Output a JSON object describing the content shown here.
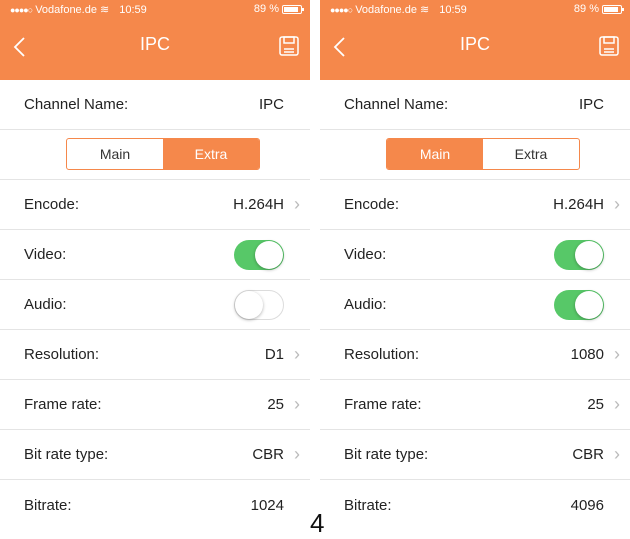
{
  "colors": {
    "accent": "#F5884B",
    "toggle_on": "#57C868"
  },
  "screens": [
    {
      "status": {
        "carrier": "Vodafone.de",
        "time": "10:59",
        "battery": "89 %",
        "battery_level": 0.89
      },
      "title": "IPC",
      "channel": {
        "label": "Channel Name:",
        "value": "IPC"
      },
      "tabs": [
        {
          "label": "Main",
          "active": false
        },
        {
          "label": "Extra",
          "active": true
        }
      ],
      "encode": {
        "label": "Encode:",
        "value": "H.264H"
      },
      "video": {
        "label": "Video:",
        "on": true
      },
      "audio": {
        "label": "Audio:",
        "on": false
      },
      "resolution": {
        "label": "Resolution:",
        "value": "D1"
      },
      "frame_rate": {
        "label": "Frame rate:",
        "value": "25"
      },
      "bit_rate_type": {
        "label": "Bit rate type:",
        "value": "CBR"
      },
      "bitrate": {
        "label": "Bitrate:",
        "value": "1024"
      }
    },
    {
      "status": {
        "carrier": "Vodafone.de",
        "time": "10:59",
        "battery": "89 %",
        "battery_level": 0.89
      },
      "title": "IPC",
      "channel": {
        "label": "Channel Name:",
        "value": "IPC"
      },
      "tabs": [
        {
          "label": "Main",
          "active": true
        },
        {
          "label": "Extra",
          "active": false
        }
      ],
      "encode": {
        "label": "Encode:",
        "value": "H.264H"
      },
      "video": {
        "label": "Video:",
        "on": true
      },
      "audio": {
        "label": "Audio:",
        "on": true
      },
      "resolution": {
        "label": "Resolution:",
        "value": "1080"
      },
      "frame_rate": {
        "label": "Frame rate:",
        "value": "25"
      },
      "bit_rate_type": {
        "label": "Bit rate type:",
        "value": "CBR"
      },
      "bitrate": {
        "label": "Bitrate:",
        "value": "4096"
      }
    }
  ],
  "footer_marker": "4"
}
